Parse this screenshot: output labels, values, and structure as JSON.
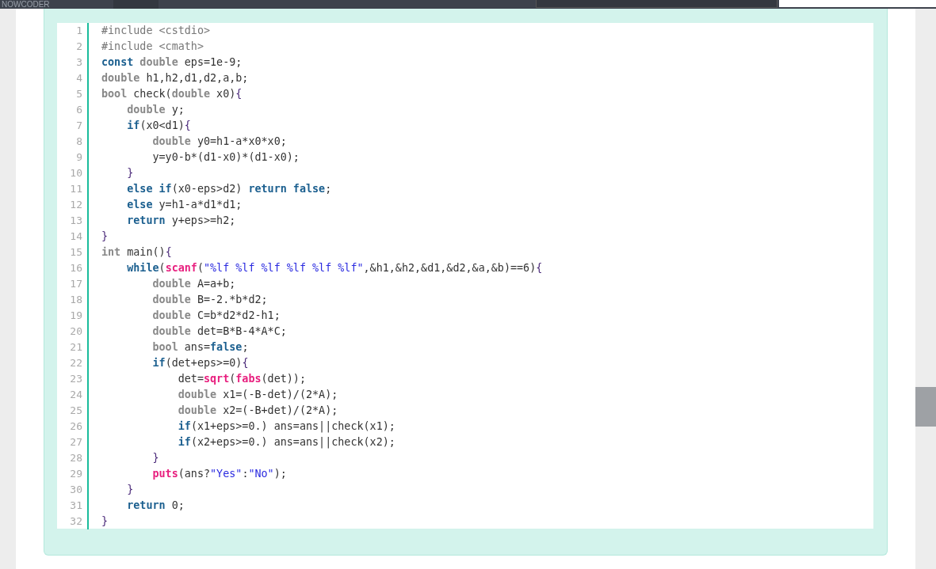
{
  "header": {
    "logo": "NOWCODER"
  },
  "code": {
    "lines": [
      {
        "number": "1",
        "tokens": [
          {
            "kind": "meta",
            "text": "#include <cstdio>"
          }
        ]
      },
      {
        "number": "2",
        "tokens": [
          {
            "kind": "meta",
            "text": "#include <cmath>"
          }
        ]
      },
      {
        "number": "3",
        "tokens": [
          {
            "kind": "keyword",
            "text": "const"
          },
          {
            "kind": "type",
            "text": " double"
          },
          {
            "kind": "plain",
            "text": " eps=1e-9;"
          }
        ]
      },
      {
        "number": "4",
        "tokens": [
          {
            "kind": "type",
            "text": "double"
          },
          {
            "kind": "plain",
            "text": " h1,h2,d1,d2,a,b;"
          }
        ]
      },
      {
        "number": "5",
        "tokens": [
          {
            "kind": "type",
            "text": "bool"
          },
          {
            "kind": "plain",
            "text": " check("
          },
          {
            "kind": "type",
            "text": "double"
          },
          {
            "kind": "plain",
            "text": " x0)"
          },
          {
            "kind": "brace",
            "text": "{"
          }
        ]
      },
      {
        "number": "6",
        "tokens": [
          {
            "kind": "type",
            "text": "    double"
          },
          {
            "kind": "plain",
            "text": " y;"
          }
        ]
      },
      {
        "number": "7",
        "tokens": [
          {
            "kind": "keyword",
            "text": "    if"
          },
          {
            "kind": "plain",
            "text": "(x0<d1)"
          },
          {
            "kind": "brace",
            "text": "{"
          }
        ]
      },
      {
        "number": "8",
        "tokens": [
          {
            "kind": "type",
            "text": "        double"
          },
          {
            "kind": "plain",
            "text": " y0=h1-a*x0*x0;"
          }
        ]
      },
      {
        "number": "9",
        "tokens": [
          {
            "kind": "plain",
            "text": "        y=y0-b*(d1-x0)*(d1-x0);"
          }
        ]
      },
      {
        "number": "10",
        "tokens": [
          {
            "kind": "brace",
            "text": "    }"
          }
        ]
      },
      {
        "number": "11",
        "tokens": [
          {
            "kind": "keyword",
            "text": "    else if"
          },
          {
            "kind": "plain",
            "text": "(x0-eps>d2) "
          },
          {
            "kind": "keyword",
            "text": "return false"
          },
          {
            "kind": "plain",
            "text": ";"
          }
        ]
      },
      {
        "number": "12",
        "tokens": [
          {
            "kind": "keyword",
            "text": "    else"
          },
          {
            "kind": "plain",
            "text": " y=h1-a*d1*d1;"
          }
        ]
      },
      {
        "number": "13",
        "tokens": [
          {
            "kind": "keyword",
            "text": "    return"
          },
          {
            "kind": "plain",
            "text": " y+eps>=h2;"
          }
        ]
      },
      {
        "number": "14",
        "tokens": [
          {
            "kind": "brace",
            "text": "}"
          }
        ]
      },
      {
        "number": "15",
        "tokens": [
          {
            "kind": "type",
            "text": "int"
          },
          {
            "kind": "plain",
            "text": " main()"
          },
          {
            "kind": "brace",
            "text": "{"
          }
        ]
      },
      {
        "number": "16",
        "tokens": [
          {
            "kind": "keyword",
            "text": "    while"
          },
          {
            "kind": "plain",
            "text": "("
          },
          {
            "kind": "builtin",
            "text": "scanf"
          },
          {
            "kind": "plain",
            "text": "("
          },
          {
            "kind": "string",
            "text": "\"%lf %lf %lf %lf %lf %lf\""
          },
          {
            "kind": "plain",
            "text": ",&h1,&h2,&d1,&d2,&a,&b)==6)"
          },
          {
            "kind": "brace",
            "text": "{"
          }
        ]
      },
      {
        "number": "17",
        "tokens": [
          {
            "kind": "type",
            "text": "        double"
          },
          {
            "kind": "plain",
            "text": " A=a+b;"
          }
        ]
      },
      {
        "number": "18",
        "tokens": [
          {
            "kind": "type",
            "text": "        double"
          },
          {
            "kind": "plain",
            "text": " B=-2.*b*d2;"
          }
        ]
      },
      {
        "number": "19",
        "tokens": [
          {
            "kind": "type",
            "text": "        double"
          },
          {
            "kind": "plain",
            "text": " C=b*d2*d2-h1;"
          }
        ]
      },
      {
        "number": "20",
        "tokens": [
          {
            "kind": "type",
            "text": "        double"
          },
          {
            "kind": "plain",
            "text": " det=B*B-4*A*C;"
          }
        ]
      },
      {
        "number": "21",
        "tokens": [
          {
            "kind": "type",
            "text": "        bool"
          },
          {
            "kind": "plain",
            "text": " ans="
          },
          {
            "kind": "keyword",
            "text": "false"
          },
          {
            "kind": "plain",
            "text": ";"
          }
        ]
      },
      {
        "number": "22",
        "tokens": [
          {
            "kind": "keyword",
            "text": "        if"
          },
          {
            "kind": "plain",
            "text": "(det+eps>=0)"
          },
          {
            "kind": "brace",
            "text": "{"
          }
        ]
      },
      {
        "number": "23",
        "tokens": [
          {
            "kind": "plain",
            "text": "            det="
          },
          {
            "kind": "builtin",
            "text": "sqrt"
          },
          {
            "kind": "plain",
            "text": "("
          },
          {
            "kind": "builtin",
            "text": "fabs"
          },
          {
            "kind": "plain",
            "text": "(det));"
          }
        ]
      },
      {
        "number": "24",
        "tokens": [
          {
            "kind": "type",
            "text": "            double"
          },
          {
            "kind": "plain",
            "text": " x1=(-B-det)/(2*A);"
          }
        ]
      },
      {
        "number": "25",
        "tokens": [
          {
            "kind": "type",
            "text": "            double"
          },
          {
            "kind": "plain",
            "text": " x2=(-B+det)/(2*A);"
          }
        ]
      },
      {
        "number": "26",
        "tokens": [
          {
            "kind": "keyword",
            "text": "            if"
          },
          {
            "kind": "plain",
            "text": "(x1+eps>=0.) ans=ans||check(x1);"
          }
        ]
      },
      {
        "number": "27",
        "tokens": [
          {
            "kind": "keyword",
            "text": "            if"
          },
          {
            "kind": "plain",
            "text": "(x2+eps>=0.) ans=ans||check(x2);"
          }
        ]
      },
      {
        "number": "28",
        "tokens": [
          {
            "kind": "brace",
            "text": "        }"
          }
        ]
      },
      {
        "number": "29",
        "tokens": [
          {
            "kind": "builtin",
            "text": "        puts"
          },
          {
            "kind": "plain",
            "text": "(ans?"
          },
          {
            "kind": "string",
            "text": "\"Yes\""
          },
          {
            "kind": "plain",
            "text": ":"
          },
          {
            "kind": "string",
            "text": "\"No\""
          },
          {
            "kind": "plain",
            "text": ");"
          }
        ]
      },
      {
        "number": "30",
        "tokens": [
          {
            "kind": "brace",
            "text": "    }"
          }
        ]
      },
      {
        "number": "31",
        "tokens": [
          {
            "kind": "keyword",
            "text": "    return"
          },
          {
            "kind": "plain",
            "text": " 0;"
          }
        ]
      },
      {
        "number": "32",
        "tokens": [
          {
            "kind": "brace",
            "text": "}"
          }
        ]
      }
    ]
  }
}
